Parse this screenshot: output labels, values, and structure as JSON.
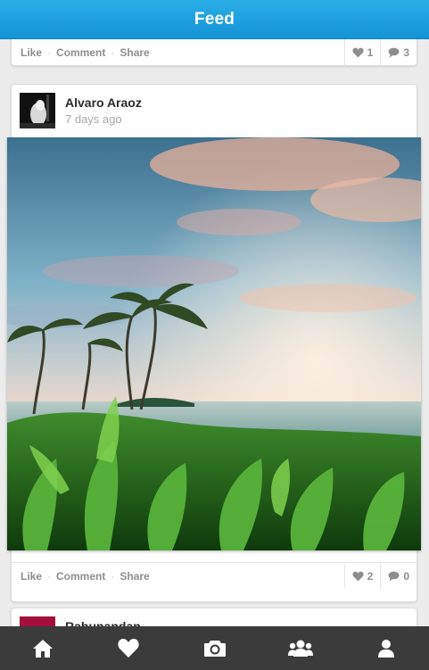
{
  "header": {
    "title": "Feed"
  },
  "posts": [
    {
      "actions": {
        "like": "Like",
        "comment": "Comment",
        "share": "Share"
      },
      "likes": "1",
      "comments": "3"
    },
    {
      "author": "Alvaro Araoz",
      "time": "7 days ago",
      "photo_icon": "tropical-beach-photo",
      "actions": {
        "like": "Like",
        "comment": "Comment",
        "share": "Share"
      },
      "likes": "2",
      "comments": "0"
    },
    {
      "author": "Rahunandan"
    }
  ],
  "tabbar": {
    "tabs": [
      {
        "icon": "home-icon"
      },
      {
        "icon": "heart-icon"
      },
      {
        "icon": "camera-icon"
      },
      {
        "icon": "people-icon"
      },
      {
        "icon": "profile-icon"
      }
    ]
  },
  "colors": {
    "header": "#1fa3e2",
    "tabbar": "#3b3b3b",
    "muted_text": "#8e8e8e"
  }
}
